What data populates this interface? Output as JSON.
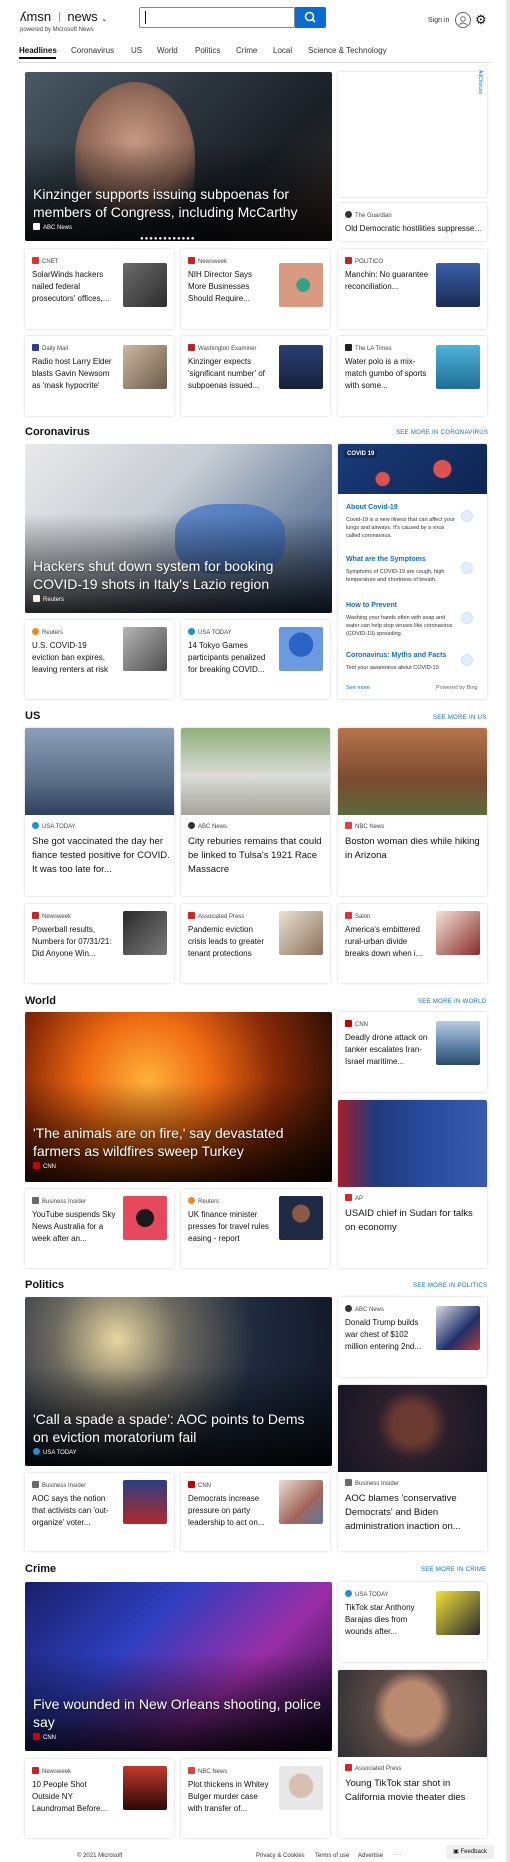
{
  "header": {
    "logo": "msn",
    "section_label": "news",
    "tagline": "powered by Microsoft News",
    "search_value": "",
    "sign_in": "Sign in"
  },
  "nav": {
    "tabs": [
      "Headlines",
      "Coronavirus",
      "US",
      "World",
      "Politics",
      "Crime",
      "Local",
      "Science & Technology"
    ]
  },
  "ad_label": "AdChoices",
  "headlines": {
    "hero": {
      "title": "Kinzinger supports issuing subpoenas for members of Congress, including McCarthy",
      "source": "ABC News"
    },
    "side_card": {
      "source": "The Guardian",
      "title": "Old Democratic hostilities suppressed in..."
    },
    "cards": [
      {
        "source": "CNET",
        "title": "SolarWinds hackers nailed federal prosecutors' offices,..."
      },
      {
        "source": "Newsweek",
        "title": "NIH Director Says More Businesses Should Require..."
      },
      {
        "source": "POLITICO",
        "title": "Manchin: No guarantee reconciliation..."
      },
      {
        "source": "Daily Mail",
        "title": "Radio host Larry Elder blasts Gavin Newsom as 'mask hypocrite'"
      },
      {
        "source": "Washington Examiner",
        "title": "Kinzinger expects 'significant number' of subpoenas issued..."
      },
      {
        "source": "The LA Times",
        "title": "Water polo is a mix-match gumbo of sports with some..."
      }
    ]
  },
  "coronavirus": {
    "heading": "Coronavirus",
    "see_more": "SEE MORE IN CORONAVIRUS",
    "hero": {
      "title": "Hackers shut down system for booking COVID-19 shots in Italy's Lazio region",
      "source": "Reuters"
    },
    "cards": [
      {
        "source": "Reuters",
        "title": "U.S. COVID-19 eviction ban expires, leaving renters at risk"
      },
      {
        "source": "USA TODAY",
        "title": "14 Tokyo Games participants penalized for breaking COVID..."
      }
    ],
    "panel": {
      "badge": "COVID 19",
      "items": [
        {
          "title": "About Covid-19",
          "text": "Covid-19 is a new illness that can affect your lungs and airways. It's caused by a virus called coronavirus."
        },
        {
          "title": "What are the Symptoms",
          "text": "Symptoms of COVID-19 are cough, high temperature and shortness of breath."
        },
        {
          "title": "How to Prevent",
          "text": "Washing your hands often with soap and water can help stop viruses like coronavirus (COVID-19) spreading."
        },
        {
          "title": "Coronavirus: Myths and Facts",
          "text": "Test your awareness about COVID-19."
        }
      ],
      "see_more": "See more",
      "powered": "Powered by Bing"
    }
  },
  "us": {
    "heading": "US",
    "see_more": "SEE MORE IN US",
    "big_cards": [
      {
        "source": "USA TODAY",
        "title": "She got vaccinated the day her fiance tested positive for COVID. It was too late for..."
      },
      {
        "source": "ABC News",
        "title": "City reburies remains that could be linked to Tulsa's 1921 Race Massacre"
      },
      {
        "source": "NBC News",
        "title": "Boston woman dies while hiking in Arizona"
      }
    ],
    "cards": [
      {
        "source": "Newsweek",
        "title": "Powerball results, Numbers for 07/31/21: Did Anyone Win..."
      },
      {
        "source": "Associated Press",
        "title": "Pandemic eviction crisis leads to greater tenant protections"
      },
      {
        "source": "Salon",
        "title": "America's embittered rural-urban divide breaks down when i..."
      }
    ]
  },
  "world": {
    "heading": "World",
    "see_more": "SEE MORE IN WORLD",
    "hero": {
      "title": "'The animals are on fire,' say devastated farmers as wildfires sweep Turkey",
      "source": "CNN"
    },
    "side_card": {
      "source": "CNN",
      "title": "Deadly drone attack on tanker escalates Iran-Israel maritime..."
    },
    "side_big": {
      "source": "AP",
      "title": "USAID chief in Sudan for talks on economy"
    },
    "cards": [
      {
        "source": "Business Insider",
        "title": "YouTube suspends Sky News Australia for a week after an..."
      },
      {
        "source": "Reuters",
        "title": "UK finance minister presses for travel rules easing - report"
      }
    ]
  },
  "politics": {
    "heading": "Politics",
    "see_more": "SEE MORE IN POLITICS",
    "hero": {
      "title": "'Call a spade a spade': AOC points to Dems on eviction moratorium fail",
      "source": "USA TODAY"
    },
    "side_card": {
      "source": "ABC News",
      "title": "Donald Trump builds war chest of $102 million entering 2nd..."
    },
    "side_big": {
      "source": "Business Insider",
      "title": "AOC blames 'conservative Democrats' and Biden administration inaction on..."
    },
    "cards": [
      {
        "source": "Business Insider",
        "title": "AOC says the notion that activists can 'out-organize' voter..."
      },
      {
        "source": "CNN",
        "title": "Democrats increase pressure on party leadership to act on..."
      }
    ]
  },
  "crime": {
    "heading": "Crime",
    "see_more": "SEE MORE IN CRIME",
    "hero": {
      "title": "Five wounded in New Orleans shooting, police say",
      "source": "CNN"
    },
    "side_card": {
      "source": "USA TODAY",
      "title": "TikTok star Anthony Barajas dies from wounds after..."
    },
    "side_big": {
      "source": "Associated Press",
      "title": "Young TikTok star shot in California movie theater dies"
    },
    "cards": [
      {
        "source": "Newsweek",
        "title": "10 People Shot Outside NY Laundromat Before..."
      },
      {
        "source": "NBC News",
        "title": "Plot thickens in Whitey Bulger murder case with transfer of..."
      }
    ]
  },
  "footer": {
    "copyright": "© 2021 Microsoft",
    "links": [
      "Privacy & Cookies",
      "Terms of use",
      "Advertise",
      "· · ·"
    ],
    "feedback": "Feedback"
  }
}
